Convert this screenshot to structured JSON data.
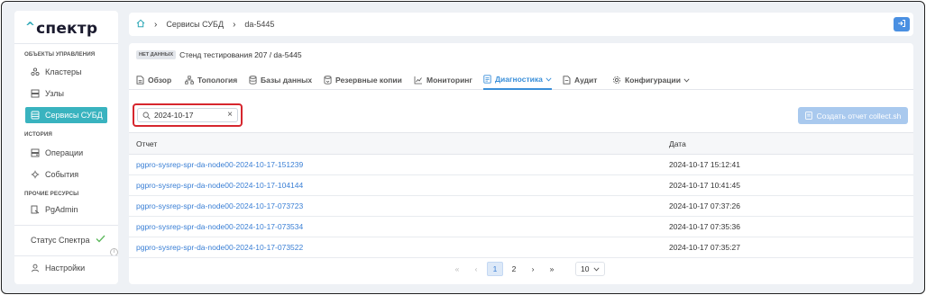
{
  "app": {
    "logo": "спектр"
  },
  "sidebar": {
    "section_objects": "ОБЪЕКТЫ УПРАВЛЕНИЯ",
    "section_history": "ИСТОРИЯ",
    "section_other": "ПРОЧИЕ РЕСУРСЫ",
    "items": [
      {
        "label": "Кластеры",
        "icon": "clusters-icon"
      },
      {
        "label": "Узлы",
        "icon": "nodes-icon"
      },
      {
        "label": "Сервисы СУБД",
        "icon": "db-services-icon",
        "active": true
      },
      {
        "label": "Операции",
        "icon": "operations-icon"
      },
      {
        "label": "События",
        "icon": "events-icon"
      },
      {
        "label": "PgAdmin",
        "icon": "pgadmin-icon"
      }
    ],
    "status_label": "Статус Спектра",
    "settings_label": "Настройки"
  },
  "breadcrumb": {
    "level1": "Сервисы СУБД",
    "level2": "da-5445"
  },
  "header": {
    "badge": "НЕТ ДАННЫХ",
    "title": "Стенд тестирования 207 /  da-5445"
  },
  "tabs": [
    {
      "label": "Обзор"
    },
    {
      "label": "Топология"
    },
    {
      "label": "Базы данных"
    },
    {
      "label": "Резервные копии"
    },
    {
      "label": "Мониторинг"
    },
    {
      "label": "Диагностика",
      "active": true
    },
    {
      "label": "Аудит"
    },
    {
      "label": "Конфигурации"
    }
  ],
  "search": {
    "value": "2024-10-17"
  },
  "create_report_label": "Создать отчет collect.sh",
  "table": {
    "col_report": "Отчет",
    "col_date": "Дата",
    "rows": [
      {
        "report": "pgpro-sysrep-spr-da-node00-2024-10-17-151239",
        "date": "2024-10-17 15:12:41"
      },
      {
        "report": "pgpro-sysrep-spr-da-node00-2024-10-17-104144",
        "date": "2024-10-17 10:41:45"
      },
      {
        "report": "pgpro-sysrep-spr-da-node00-2024-10-17-073723",
        "date": "2024-10-17 07:37:26"
      },
      {
        "report": "pgpro-sysrep-spr-da-node00-2024-10-17-073534",
        "date": "2024-10-17 07:35:36"
      },
      {
        "report": "pgpro-sysrep-spr-da-node00-2024-10-17-073522",
        "date": "2024-10-17 07:35:27"
      }
    ]
  },
  "pagination": {
    "first": "«",
    "prev": "‹",
    "page1": "1",
    "page2": "2",
    "next": "›",
    "last": "»",
    "per_page": "10"
  },
  "colors": {
    "accent": "#39b3bf",
    "link": "#3a7fd5",
    "highlight": "#d6262e"
  }
}
